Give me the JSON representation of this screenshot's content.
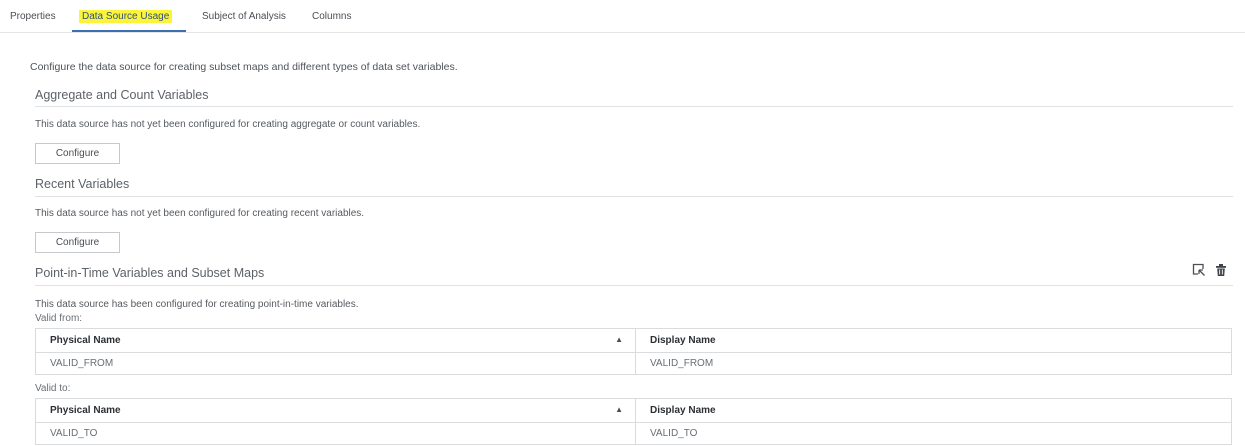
{
  "tabs": [
    {
      "label": "Properties",
      "active": false
    },
    {
      "label": "Data Source Usage",
      "active": true
    },
    {
      "label": "Subject of Analysis",
      "active": false
    },
    {
      "label": "Columns",
      "active": false
    }
  ],
  "intro": "Configure the data source for creating subset maps and different types of data set variables.",
  "aggregate": {
    "title": "Aggregate and Count Variables",
    "description": "This data source has not yet been configured for creating aggregate or count variables.",
    "button": "Configure"
  },
  "recent": {
    "title": "Recent Variables",
    "description": "This data source has not yet been configured for creating recent variables.",
    "button": "Configure"
  },
  "pit": {
    "title": "Point-in-Time Variables and Subset Maps",
    "description": "This data source has been configured for creating point-in-time variables.",
    "edit_icon": "edit-select-icon",
    "delete_icon": "trash-icon",
    "valid_from": {
      "label": "Valid from:",
      "columns": [
        "Physical Name",
        "Display Name"
      ],
      "sort_indicator": "▲",
      "row": [
        "VALID_FROM",
        "VALID_FROM"
      ]
    },
    "valid_to": {
      "label": "Valid to:",
      "columns": [
        "Physical Name",
        "Display Name"
      ],
      "sort_indicator": "▲",
      "row": [
        "VALID_TO",
        "VALID_TO"
      ]
    }
  },
  "colors": {
    "tab_highlight": "#fbf43a",
    "tab_underline": "#3c6fb0",
    "border": "#d9dcdf"
  }
}
